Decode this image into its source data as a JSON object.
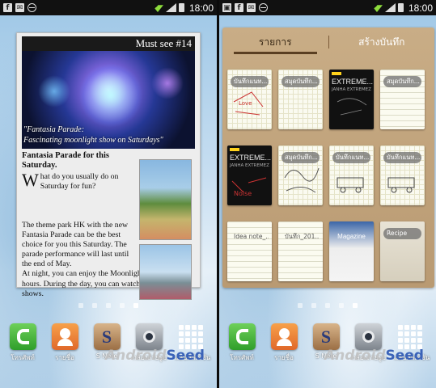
{
  "status_bar": {
    "time": "18:00",
    "icons": [
      "facebook-icon",
      "mail-icon",
      "blocked-icon",
      "wifi-icon",
      "signal-icon",
      "battery-icon"
    ]
  },
  "must_see": {
    "header": "Must see #14",
    "caption_line1": "\"Fantasia Parade:",
    "caption_line2": "Fascinating moonlight show on Saturdays\"",
    "title": "Fantasia Parade for this Saturday.",
    "dropcap": "W",
    "intro": "hat do you usually do on Saturday for fun?",
    "body1": "The theme park HK with the new Fantasia Parade can be the best choice for you this Saturday. The parade performance will last until the end of May.",
    "body2": "At night, you can enjoy the Moonlight show for 2 hours. During the day, you can watch special water shows."
  },
  "memo": {
    "tab_list": "รายการ",
    "tab_create": "สร้างบันทึก",
    "notes": [
      {
        "kind": "grid",
        "label": "บันทึกแนท..."
      },
      {
        "kind": "grid",
        "label": "สมุดบันทึก..."
      },
      {
        "kind": "dark",
        "title": "EXTREME...",
        "sub": "JANHA EXTREMEZ"
      },
      {
        "kind": "lined",
        "label": "สมุดบันทึก..."
      },
      {
        "kind": "dark",
        "title": "EXTREME...",
        "sub": "JANHA EXTREMEZ"
      },
      {
        "kind": "grid",
        "label": "สมุดบันทึก..."
      },
      {
        "kind": "grid",
        "label": "บันทึกแนท..."
      },
      {
        "kind": "grid",
        "label": "บันทึกแนท..."
      },
      {
        "kind": "lined",
        "label": "Idea note_..."
      },
      {
        "kind": "lined",
        "label": "บันทึก_201..."
      },
      {
        "kind": "magazine",
        "label": "Magazine"
      },
      {
        "kind": "recipe",
        "label": "Recipe"
      }
    ]
  },
  "page_indicator": {
    "count": 5,
    "active": 4
  },
  "dock": {
    "phone": "โทรศัพท์",
    "contacts": "รายชื่อ",
    "s_label": "S",
    "s_name": "S Note",
    "camera": "กล้องถ่ายรูป",
    "apps": "แอปพลิเคชัน"
  },
  "watermark": {
    "part1": "Android",
    "part2": "Seed"
  }
}
